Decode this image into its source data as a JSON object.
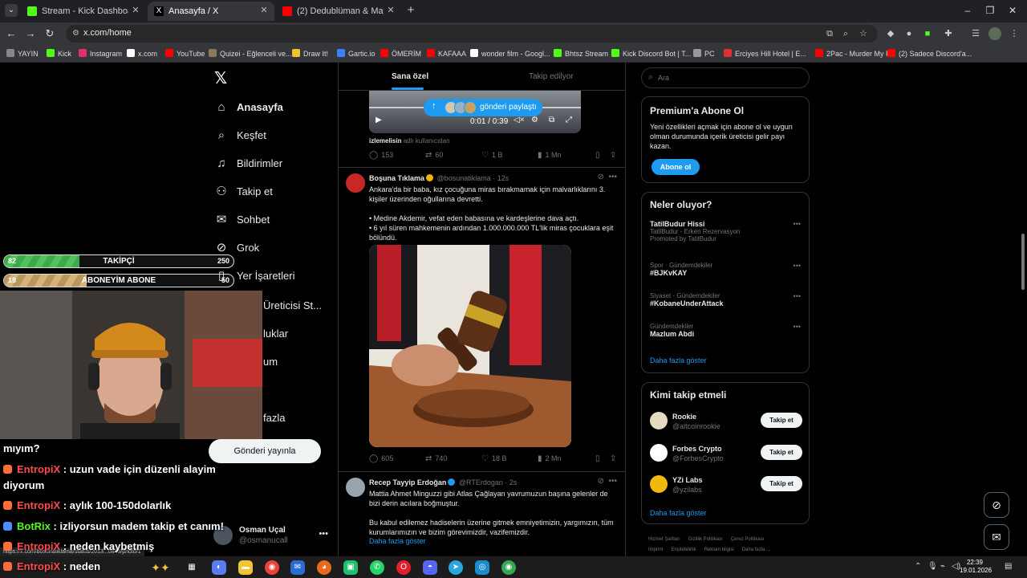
{
  "browser": {
    "tabs": [
      {
        "title": "Stream - Kick Dashboard",
        "color": "#53fc18"
      },
      {
        "title": "Anasayfa / X",
        "color": "#000000"
      },
      {
        "title": "(2) Dedublüman & Mavzer Tab",
        "color": "#ff0000"
      }
    ],
    "url": "x.com/home",
    "bookmarks": [
      {
        "label": "YAYIN",
        "color": "#888888"
      },
      {
        "label": "Kick",
        "color": "#53fc18"
      },
      {
        "label": "Instagram",
        "color": "#e1306c"
      },
      {
        "label": "x.com",
        "color": "#ffffff"
      },
      {
        "label": "YouTube",
        "color": "#ff0000"
      },
      {
        "label": "Quizei - Eğlenceli ve...",
        "color": "#8a7a5a"
      },
      {
        "label": "Draw It!",
        "color": "#f4c430"
      },
      {
        "label": "Gartic.io",
        "color": "#3b82f6"
      },
      {
        "label": "ÖMERİM",
        "color": "#ff0000"
      },
      {
        "label": "KAFAAA",
        "color": "#ff0000"
      },
      {
        "label": "wonder film - Googl...",
        "color": "#ffffff"
      },
      {
        "label": "Bhtsz Stream",
        "color": "#53fc18"
      },
      {
        "label": "Kick Discord Bot | T...",
        "color": "#53fc18"
      },
      {
        "label": "PC",
        "color": "#999999"
      },
      {
        "label": "Erciyes Hill Hotel | E...",
        "color": "#e03030"
      },
      {
        "label": "2Pac - Murder My F...",
        "color": "#ff0000"
      },
      {
        "label": "(2) Sadece Discord'a...",
        "color": "#ff0000"
      }
    ]
  },
  "nav": {
    "items": [
      {
        "label": "Anasayfa",
        "icon": "home-icon",
        "glyph": "⌂"
      },
      {
        "label": "Keşfet",
        "icon": "search-icon",
        "glyph": "⌕"
      },
      {
        "label": "Bildirimler",
        "icon": "bell-icon",
        "glyph": "♫"
      },
      {
        "label": "Takip et",
        "icon": "follow-icon",
        "glyph": "⚇"
      },
      {
        "label": "Sohbet",
        "icon": "mail-icon",
        "glyph": "✉"
      },
      {
        "label": "Grok",
        "icon": "grok-icon",
        "glyph": "⊘"
      },
      {
        "label": "Yer İşaretleri",
        "icon": "bookmark-icon",
        "glyph": "▯"
      }
    ],
    "partial_labels": [
      "Üreticisi St...",
      "luklar",
      "um",
      "fazla"
    ],
    "post_button": "Gönderi yayınla",
    "account": {
      "name": "Osman Uçal",
      "handle": "@osmanucall"
    }
  },
  "feed": {
    "tabs": [
      "Sana özel",
      "Takip edilyor"
    ],
    "video": {
      "pill": "gönderi paylaştı",
      "time": "0:01 / 0:39",
      "note_bold": "izlemelisin",
      "note": "adlı kullanıcıdan"
    },
    "first_actions": {
      "replies": "153",
      "reposts": "60",
      "likes": "1 B",
      "views": "1 Mn"
    },
    "posts": [
      {
        "name": "Boşuna Tıklama",
        "handle": "@bosunatiklama · 12s",
        "avatar_color": "#c62828",
        "text1": "Ankara'da bir baba, kız çocuğuna miras bırakmamak için malvarlıklarını 3. kişiler üzerinden oğullarına devretti.",
        "text2": "• Medine Akdemir, vefat eden babasına ve kardeşlerine dava açtı.",
        "text3": "• 6 yıl süren mahkemenin ardından 1.000.000.000 TL'lik miras çocuklara eşit bölündü.",
        "replies": "605",
        "reposts": "740",
        "likes": "18 B",
        "views": "2 Mn"
      },
      {
        "name": "Recep Tayyip Erdoğan",
        "handle": "@RTErdogan · 2s",
        "avatar_color": "#9aa4ad",
        "text1": "Mattia Ahmet Minguzzi gibi Atlas Çağlayan yavrumuzun başına gelenler de bizi derin acılara boğmuştur.",
        "text2": "Bu kabul edilemez hadiselerin üzerine gitmek emniyetimizin, yargımızın, tüm kurumlarımızın ve bizim görevimizdir, vazifemizdir.",
        "more": "Daha fazla göster"
      }
    ]
  },
  "sidebar": {
    "search_placeholder": "Ara",
    "premium": {
      "title": "Premium'a Abone Ol",
      "text": "Yeni özellikleri açmak için abone ol ve uygun olman durumunda içerik üreticisi gelir payı kazan.",
      "button": "Abone ol"
    },
    "trends": {
      "title": "Neler oluyor?",
      "items": [
        {
          "category": "",
          "name": "TatilBudur Hissi",
          "sub": "TatilBudur - Erken Rezervasyon",
          "promo": "Promoted by TatilBudur"
        },
        {
          "category": "Spor · Gündemdekiler",
          "name": "#BJKvKAY",
          "sub": "",
          "promo": ""
        },
        {
          "category": "Siyaset · Gündemdekiler",
          "name": "#KobaneUnderAttack",
          "sub": "",
          "promo": ""
        },
        {
          "category": "Gündemdekiler",
          "name": "Mazlum Abdi",
          "sub": "",
          "promo": ""
        }
      ],
      "more": "Daha fazla göster"
    },
    "who_to_follow": {
      "title": "Kimi takip etmeli",
      "items": [
        {
          "name": "Rookie",
          "handle": "@altcoinrookie",
          "button": "Takip et",
          "color": "#e8d9c3"
        },
        {
          "name": "Forbes Crypto",
          "handle": "@ForbesCrypto",
          "button": "Takip et",
          "color": "#ffffff"
        },
        {
          "name": "YZi Labs",
          "handle": "@yzilabs",
          "button": "Takip et",
          "color": "#f0b90b"
        }
      ],
      "more": "Daha fazla göster"
    },
    "footer": [
      "Hizmet Şartları",
      "Gizlilik Politikası",
      "Çerez Politikası",
      "Imprint",
      "Erişilebilirlik",
      "Reklam bilgisi",
      "Daha fazla ..."
    ]
  },
  "stream": {
    "followers_bar": {
      "current": "82",
      "label": "TAKİPÇİ",
      "goal": "250",
      "fraction": 0.33
    },
    "subs_bar": {
      "current": "18",
      "label": "ABONEYİM ABONE",
      "goal": "50",
      "fraction": 0.36
    },
    "chat": [
      {
        "user": "",
        "text": "mıyım?",
        "bot": false
      },
      {
        "user": "EntropiX",
        "text": ": uzun vade için düzenli alayim",
        "bot": false
      },
      {
        "user": "",
        "text": "diyorum",
        "bot": false
      },
      {
        "user": "EntropiX",
        "text": ": aylık 100-150dolarlık",
        "bot": false
      },
      {
        "user": "BotRix",
        "text": ": izliyorsun madem takip et canım!",
        "bot": true
      },
      {
        "user": "EntropiX",
        "text": ": neden kaybetmiş",
        "bot": false
      },
      {
        "user": "EntropiX",
        "text": ": neden",
        "bot": false
      }
    ],
    "status_url": "https://x.com/bosunatiklama/status/2013...0849/photo/1"
  },
  "taskbar": {
    "time": "22:39",
    "date": "19.01.2026"
  }
}
